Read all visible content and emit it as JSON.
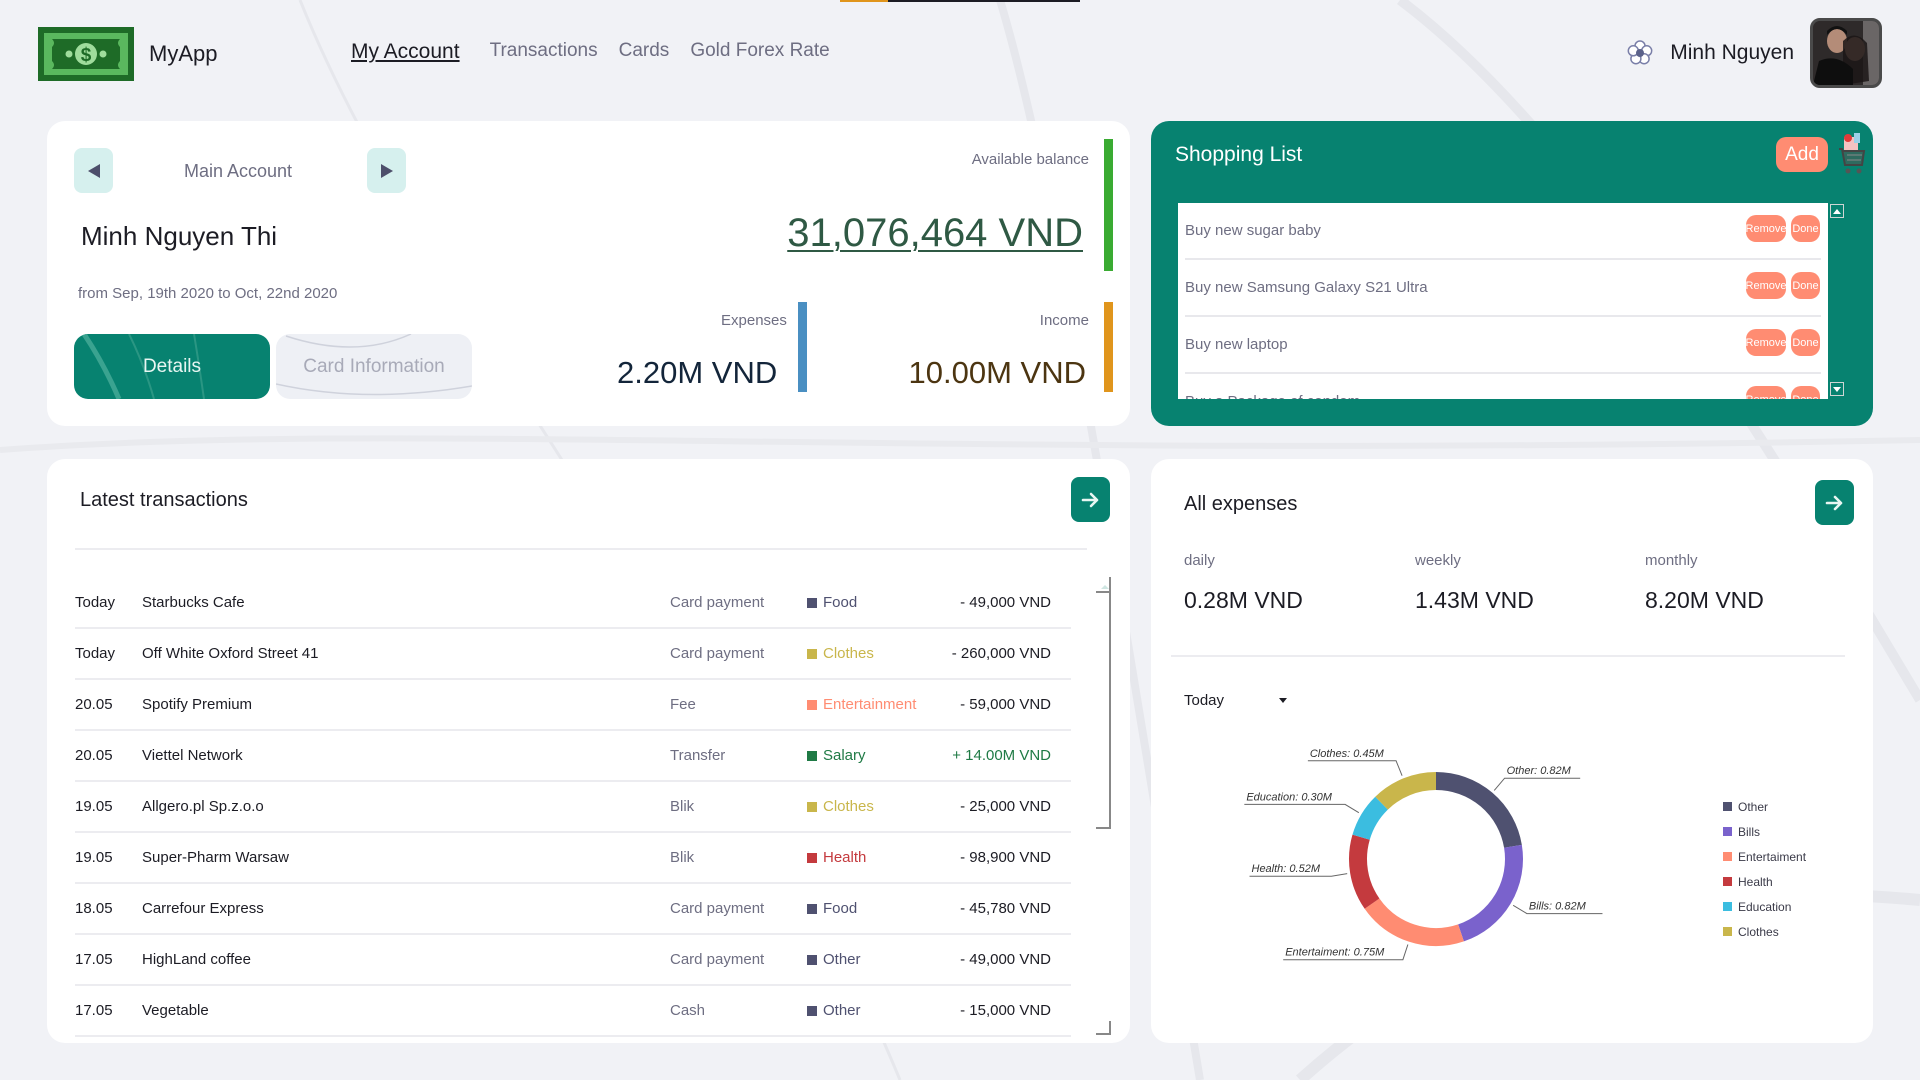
{
  "header": {
    "app_name": "MyApp",
    "nav": [
      {
        "label": "My Account",
        "active": true
      },
      {
        "label": "Transactions",
        "active": false
      },
      {
        "label": "Cards",
        "active": false
      },
      {
        "label": "Gold Forex Rate",
        "active": false
      }
    ],
    "user_name": "Minh Nguyen",
    "icons": {
      "logo": "money-bill-icon",
      "settings": "flower-icon",
      "avatar": "user-avatar-photo"
    }
  },
  "account": {
    "account_label": "Main Account",
    "holder_name": "Minh Nguyen Thi",
    "period": "from Sep, 19th 2020 to Oct, 22nd 2020",
    "tabs": [
      "Details",
      "Card Information"
    ],
    "active_tab": "Details",
    "balance_label": "Available balance",
    "balance_value": "31,076,464 VND",
    "expenses_label": "Expenses",
    "expenses_value": "2.20M VND",
    "income_label": "Income",
    "income_value": "10.00M VND",
    "colors": {
      "balance_bar": "#3aab32",
      "expenses_bar": "#4a8fc2",
      "income_bar": "#e0951c"
    }
  },
  "shopping": {
    "title": "Shopping List",
    "add_label": "Add",
    "remove_label": "Remove",
    "done_label": "Done",
    "items": [
      "Buy new sugar baby",
      "Buy new Samsung Galaxy S21 Ultra",
      "Buy new laptop",
      "Buy a Package of condom"
    ]
  },
  "transactions": {
    "title": "Latest transactions",
    "rows": [
      {
        "date": "Today",
        "name": "Starbucks Cafe",
        "method": "Card payment",
        "category": "Food",
        "cat_color": "#4f5170",
        "amount": "- 49,000 VND",
        "amount_color": "#1c1c24"
      },
      {
        "date": "Today",
        "name": "Off White Oxford Street 41",
        "method": "Card payment",
        "category": "Clothes",
        "cat_color": "#c9b64b",
        "amount": "- 260,000 VND",
        "amount_color": "#1c1c24"
      },
      {
        "date": "20.05",
        "name": "Spotify Premium",
        "method": "Fee",
        "category": "Entertainment",
        "cat_color": "#ff8c72",
        "amount": "- 59,000 VND",
        "amount_color": "#1c1c24"
      },
      {
        "date": "20.05",
        "name": "Viettel Network",
        "method": "Transfer",
        "category": "Salary",
        "cat_color": "#1f7a45",
        "amount": "+ 14.00M VND",
        "amount_color": "#1f7a45"
      },
      {
        "date": "19.05",
        "name": "Allgero.pl Sp.z.o.o",
        "method": "Blik",
        "category": "Clothes",
        "cat_color": "#c9b64b",
        "amount": "- 25,000 VND",
        "amount_color": "#1c1c24"
      },
      {
        "date": "19.05",
        "name": "Super-Pharm Warsaw",
        "method": "Blik",
        "category": "Health",
        "cat_color": "#c43a3e",
        "amount": "- 98,900 VND",
        "amount_color": "#1c1c24"
      },
      {
        "date": "18.05",
        "name": "Carrefour Express",
        "method": "Card payment",
        "category": "Food",
        "cat_color": "#4f5170",
        "amount": "- 45,780 VND",
        "amount_color": "#1c1c24"
      },
      {
        "date": "17.05",
        "name": "HighLand coffee",
        "method": "Card payment",
        "category": "Other",
        "cat_color": "#4f5170",
        "amount": "- 49,000 VND",
        "amount_color": "#1c1c24"
      },
      {
        "date": "17.05",
        "name": "Vegetable",
        "method": "Cash",
        "category": "Other",
        "cat_color": "#4f5170",
        "amount": "- 15,000 VND",
        "amount_color": "#1c1c24"
      }
    ]
  },
  "expenses": {
    "title": "All expenses",
    "periods": [
      {
        "label": "daily",
        "value": "0.28M VND"
      },
      {
        "label": "weekly",
        "value": "1.43M VND"
      },
      {
        "label": "monthly",
        "value": "8.20M VND"
      }
    ],
    "range_selected": "Today"
  },
  "chart_data": {
    "type": "pie",
    "variant": "donut",
    "title": "",
    "unit": "M VND",
    "slices": [
      {
        "label": "Other",
        "value": 0.82,
        "display": "Other: 0.82M",
        "color": "#4f5170"
      },
      {
        "label": "Bills",
        "value": 0.82,
        "display": "Bills: 0.82M",
        "color": "#7a62cc"
      },
      {
        "label": "Entertaiment",
        "value": 0.75,
        "display": "Entertaiment: 0.75M",
        "color": "#ff8c72"
      },
      {
        "label": "Health",
        "value": 0.52,
        "display": "Health: 0.52M",
        "color": "#c43a3e"
      },
      {
        "label": "Education",
        "value": 0.3,
        "display": "Education: 0.30M",
        "color": "#3bbde0"
      },
      {
        "label": "Clothes",
        "value": 0.45,
        "display": "Clothes: 0.45M",
        "color": "#c9b64b"
      }
    ],
    "legend": [
      "Other",
      "Bills",
      "Entertaiment",
      "Health",
      "Education",
      "Clothes"
    ],
    "legend_position": "right"
  }
}
